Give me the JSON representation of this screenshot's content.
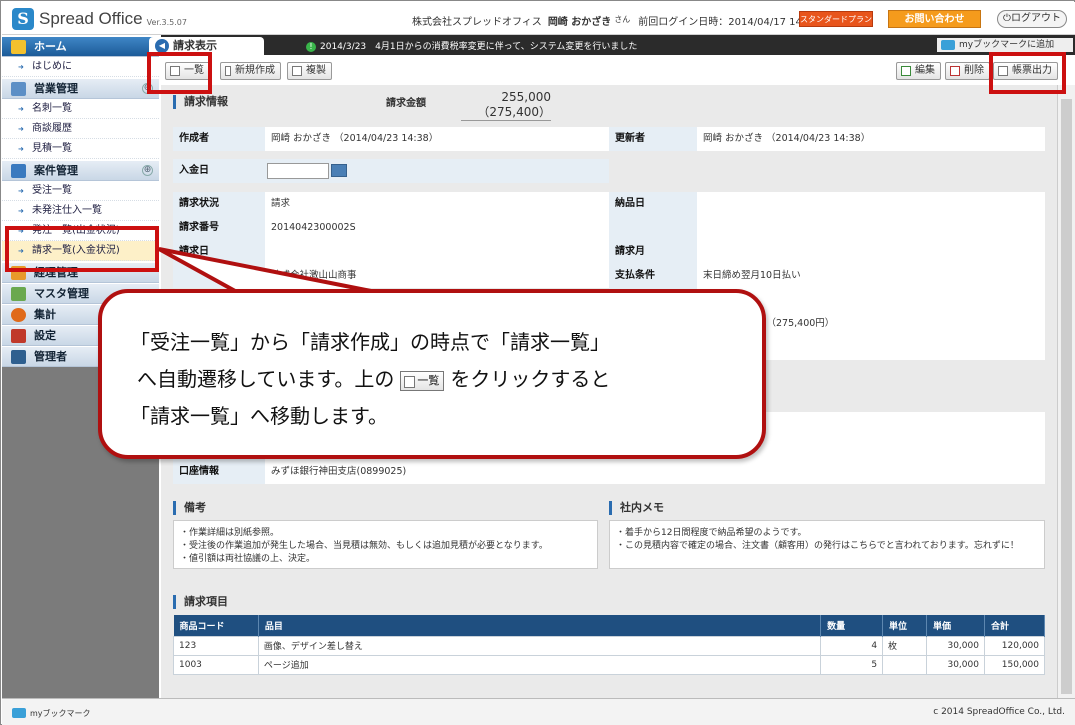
{
  "header": {
    "logo_text": "Spread Office",
    "version": "Ver.3.5.07",
    "company": "株式会社スプレッドオフィス",
    "user": "岡崎 おかざき",
    "san": "さん",
    "last_login": "前回ログイン日時：2014/04/17 14:45:55",
    "plan": "スタンダードプラン",
    "contact": "お問い合わせ",
    "logout": "ログアウト"
  },
  "sidebar": {
    "home": "ホーム",
    "intro": "はじめに",
    "sales": "営業管理",
    "meishi": "名刺一覧",
    "shodan": "商談履歴",
    "mitsumori": "見積一覧",
    "anken": "案件管理",
    "juchu": "受注一覧",
    "mihacchu": "未発注仕入一覧",
    "hidden_item": "発注一覧(出金状況)",
    "seikyu": "請求一覧(入金状況)",
    "keiri": "経理管理",
    "master": "マスタ管理",
    "shukei": "集計",
    "settei": "設定",
    "kanri": "管理者"
  },
  "topbar": {
    "tab": "請求表示",
    "notice": "2014/3/23　4月1日からの消費税率変更に伴って、システム変更を行いました",
    "bookmark": "myブックマークに追加"
  },
  "toolbar": {
    "list": "一覧",
    "new": "新規作成",
    "copy": "複製",
    "edit": "編集",
    "delete": "削除",
    "print": "帳票出力"
  },
  "invoice": {
    "section": "請求情報",
    "amount_label": "請求金額",
    "amount": "255,000",
    "amount_tax": "（275,400）",
    "creator_label": "作成者",
    "creator": "岡崎 おかざき （2014/04/23 14:38）",
    "updater_label": "更新者",
    "updater": "岡崎 おかざき （2014/04/23 14:38）",
    "payment_date_label": "入金日",
    "status_label": "請求状況",
    "status": "請求",
    "delivery_label": "納品日",
    "number_label": "請求番号",
    "number": "2014042300002S",
    "date_label": "請求日",
    "month_label": "請求月",
    "client_fragment": "株式会社激山山商事",
    "terms_label": "支払条件",
    "terms": "末日締め翌月10日払い",
    "total_fragment": "円（275,400円）",
    "bank_label": "口座情報",
    "bank": "みずほ銀行神田支店(0899025)"
  },
  "notes": {
    "bikou_title": "備考",
    "bikou": [
      "・作業詳細は別紙参照。",
      "・受注後の作業追加が発生した場合、当見積は無効、もしくは追加見積が必要となります。",
      "・値引額は両社協議の上、決定。"
    ],
    "memo_title": "社内メモ",
    "memo": [
      "・着手から12日間程度で納品希望のようです。",
      "・この見積内容で確定の場合、注文書（顧客用）の発行はこちらでと言われております。忘れずに！"
    ]
  },
  "items": {
    "title": "請求項目",
    "headers": [
      "商品コード",
      "品目",
      "数量",
      "単位",
      "単価",
      "合計"
    ],
    "rows": [
      [
        "123",
        "画像、デザイン差し替え",
        "4",
        "枚",
        "30,000",
        "120,000"
      ],
      [
        "1003",
        "ページ追加",
        "5",
        "",
        "30,000",
        "150,000"
      ]
    ]
  },
  "footer": {
    "bookmark": "myブックマーク",
    "copyright": "c 2014 SpreadOffice Co., Ltd."
  },
  "callout": {
    "line1": "「受注一覧」から「請求作成」の時点で「請求一覧」",
    "line2a": "へ自動遷移しています。上の",
    "line2b": "をクリックすると",
    "line3": "「請求一覧」へ移動します。",
    "button": "一覧"
  }
}
